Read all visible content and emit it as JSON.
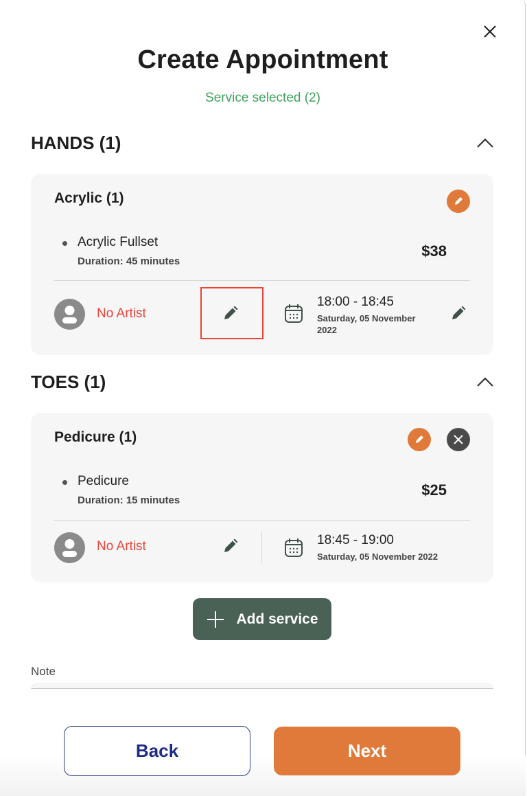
{
  "header": {
    "title": "Create Appointment",
    "subtitle": "Service selected (2)",
    "close_icon": "close-icon"
  },
  "sections": [
    {
      "title": "HANDS (1)",
      "toggle_icon": "chevron-up-icon",
      "card": {
        "name": "Acrylic (1)",
        "actions": [
          "edit-service"
        ],
        "service": {
          "name": "Acrylic Fullset",
          "duration": "Duration: 45 minutes",
          "price": "$38"
        },
        "artist": "No Artist",
        "time": "18:00 - 18:45",
        "date": "Saturday, 05 November 2022"
      }
    },
    {
      "title": "TOES (1)",
      "toggle_icon": "chevron-up-icon",
      "card": {
        "name": "Pedicure (1)",
        "actions": [
          "edit-service",
          "remove-service"
        ],
        "service": {
          "name": "Pedicure",
          "duration": "Duration: 15 minutes",
          "price": "$25"
        },
        "artist": "No Artist",
        "time": "18:45 - 19:00",
        "date": "Saturday, 05 November 2022"
      }
    }
  ],
  "add_service": {
    "label": "Add service",
    "icon": "plus-icon"
  },
  "note": {
    "label": "Note",
    "value": ""
  },
  "footer": {
    "back_label": "Back",
    "next_label": "Next"
  },
  "colors": {
    "accent_orange": "#e07a3a",
    "primary_green": "#4a6155",
    "success_green": "#3fa35c",
    "error_red": "#e8443a",
    "navy": "#1f2c84"
  }
}
